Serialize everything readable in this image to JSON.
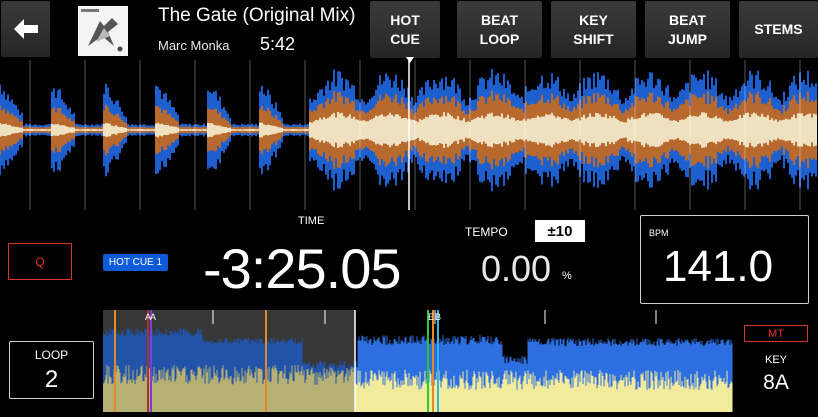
{
  "track": {
    "title": "The Gate (Original Mix)",
    "artist": "Marc Monka",
    "length": "5:42"
  },
  "header": {
    "back_icon": "arrow-left-icon",
    "buttons": [
      {
        "id": "hot-cue",
        "label": "HOT\nCUE"
      },
      {
        "id": "beat-loop",
        "label": "BEAT\nLOOP"
      },
      {
        "id": "key-shift",
        "label": "KEY\nSHIFT"
      },
      {
        "id": "beat-jump",
        "label": "BEAT\nJUMP"
      },
      {
        "id": "stems",
        "label": "STEMS"
      }
    ]
  },
  "cue": {
    "q_label": "Q",
    "hot_cue_label": "HOT CUE 1"
  },
  "time": {
    "label": "TIME",
    "value": "-3:25.05"
  },
  "tempo": {
    "label": "TEMPO",
    "range": "±10",
    "value": "0.00",
    "unit": "%"
  },
  "bpm": {
    "label": "BPM",
    "value": "141.0"
  },
  "loop": {
    "label": "LOOP",
    "value": "2"
  },
  "overview": {
    "markers": [
      "A",
      "A",
      "E",
      "B"
    ],
    "played_fraction": 0.4
  },
  "key": {
    "mt_label": "MT",
    "label": "KEY",
    "value": "8A"
  },
  "colors": {
    "accent_red": "#e0312e",
    "hot_cue_blue": "#0d5bd8",
    "wave_blue": "#1e5fd0",
    "wave_orange": "#b8692e",
    "wave_cream": "#efe0c0",
    "overview_yellow": "#f3eb9c"
  }
}
